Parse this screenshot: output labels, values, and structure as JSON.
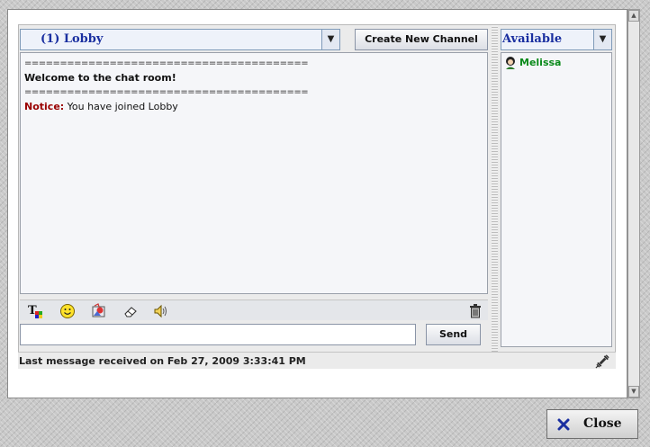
{
  "channel": {
    "selected": "(1) Lobby"
  },
  "buttons": {
    "create_channel": "Create New Channel",
    "send": "Send",
    "close": "Close"
  },
  "messages": {
    "separator": "========================================",
    "welcome": "Welcome to the chat room!",
    "notice_label": "Notice:",
    "notice_text": " You have joined Lobby"
  },
  "status_select": {
    "selected": "Available"
  },
  "users": [
    {
      "name": "Melissa"
    }
  ],
  "input": {
    "value": ""
  },
  "statusbar": {
    "text": "Last message received on Feb 27, 2009 3:33:41 PM"
  },
  "colors": {
    "link_blue": "#1a2fa0",
    "notice_red": "#990000",
    "user_green": "#0a8a1a"
  },
  "icons": {
    "toolbar": [
      "text-format-icon",
      "smiley-icon",
      "image-icon",
      "eraser-icon",
      "speaker-icon",
      "trash-icon"
    ],
    "status": "plug-icon",
    "close": "close-x-icon"
  }
}
